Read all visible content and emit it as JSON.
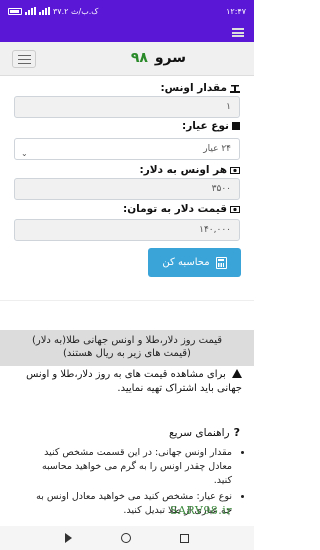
{
  "status": {
    "time": "۱۲:۴۷",
    "speed": "۳۷.۲ ک.ب/ث",
    "battery": "۸۵"
  },
  "brand": {
    "name": "سرو",
    "number": "۹۸"
  },
  "form": {
    "ounce_label": "مقدار اونس:",
    "ounce_value": "۱",
    "type_label": "نوع عیار:",
    "type_value": "۲۴ عیار",
    "usd_label": "هر اونس به دلار:",
    "usd_value": "۳۵۰۰",
    "toman_label": "قیمت دلار به تومان:",
    "toman_value": "۱۴۰,۰۰۰",
    "submit_label": "محاسبه کن"
  },
  "info": {
    "box_line1": "قیمت روز دلار،طلا و اونس جهانی طلا(به دلار)",
    "box_line2": "(قیمت های زیر به ریال هستند)",
    "warning": "برای مشاهده قیمت های به روز دلار،طلا و اونس جهانی باید اشتراک تهیه نمایید."
  },
  "guide": {
    "title": "راهنمای سریع",
    "items": [
      "مقدار اونس جهانی: در این قسمت مشخص کنید معادل چقدر اونس را به گرم می خواهید محاسبه کنید.",
      "نوع عیار: مشخص کنید می خواهید معادل اونس به چه عیاری از طلا تبدیل کنید."
    ]
  },
  "watermark": "SARV98.ir",
  "icons": {
    "scale": "scale-icon",
    "square": "square-icon",
    "money": "money-icon",
    "calculator": "calculator-icon",
    "warning": "warning-icon",
    "question": "question-icon"
  },
  "colors": {
    "statusbar": "#5a17d6",
    "button": "#3aa3d8",
    "brand_number": "#2a8a2a",
    "infobox": "#dcdcdc"
  }
}
